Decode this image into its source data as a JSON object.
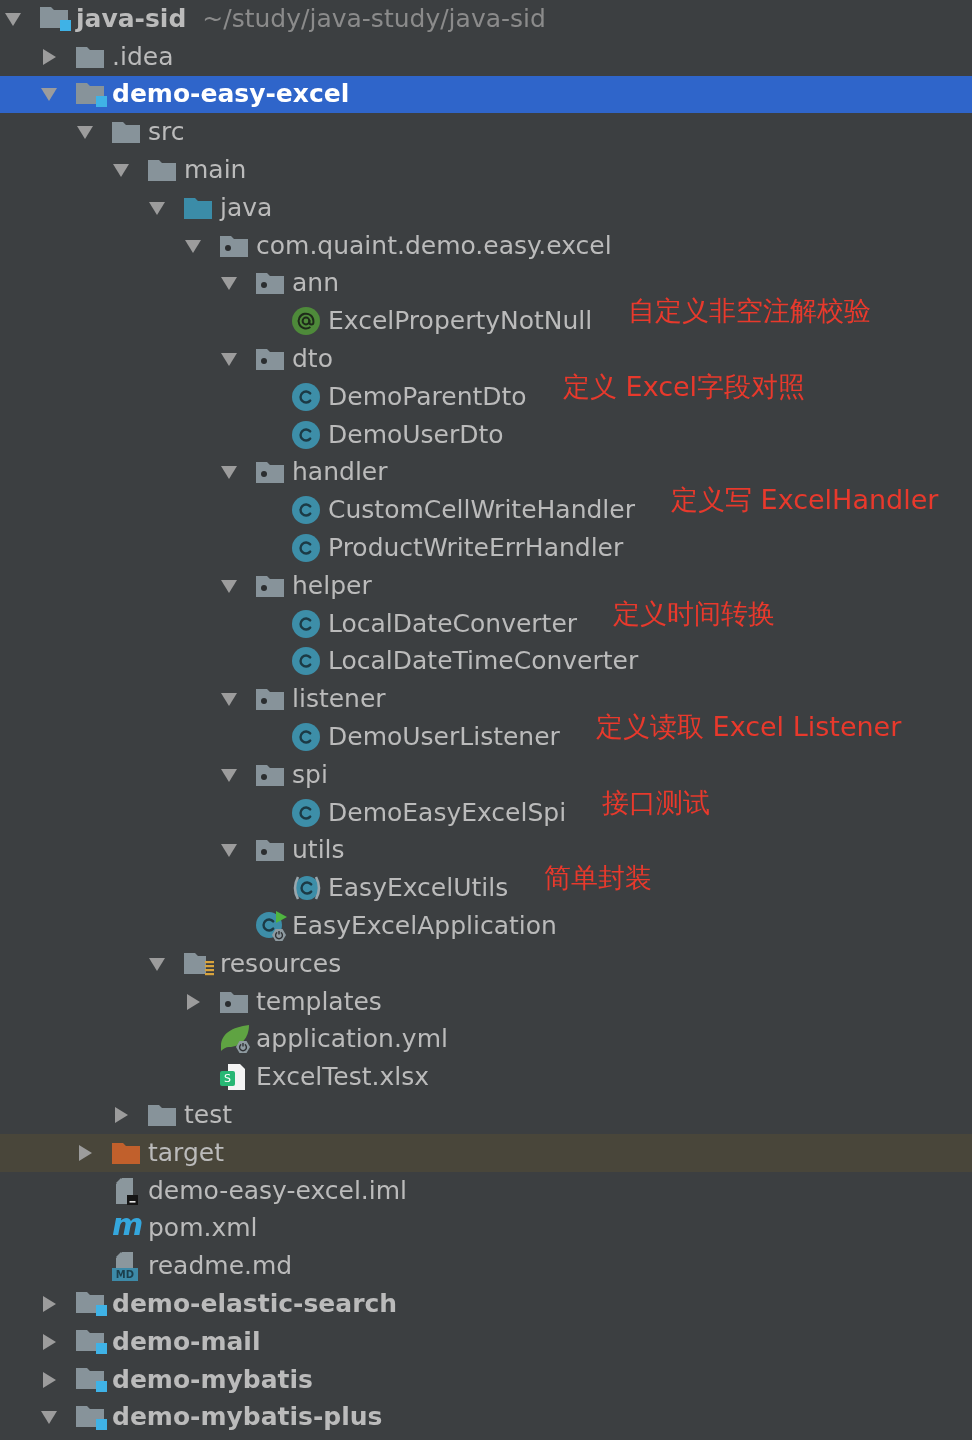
{
  "tree": [
    {
      "label": "java-sid",
      "kind": "module",
      "path": "~/study/java-study/java-sid",
      "expanded": true,
      "selected": false,
      "children": [
        {
          "label": ".idea",
          "kind": "folder",
          "expanded": false,
          "selected": false
        },
        {
          "label": "demo-easy-excel",
          "kind": "module",
          "expanded": true,
          "selected": true,
          "children": [
            {
              "label": "src",
              "kind": "folder",
              "expanded": true,
              "selected": false,
              "children": [
                {
                  "label": "main",
                  "kind": "folder",
                  "expanded": true,
                  "selected": false,
                  "children": [
                    {
                      "label": "java",
                      "kind": "source-folder",
                      "expanded": true,
                      "selected": false,
                      "children": [
                        {
                          "label": "com.quaint.demo.easy.excel",
                          "kind": "package",
                          "expanded": true,
                          "selected": false,
                          "children": [
                            {
                              "label": "ann",
                              "kind": "package",
                              "expanded": true,
                              "selected": false,
                              "children": [
                                {
                                  "label": "ExcelPropertyNotNull",
                                  "kind": "annotation",
                                  "selected": false,
                                  "note": "自定义非空注解校验"
                                }
                              ]
                            },
                            {
                              "label": "dto",
                              "kind": "package",
                              "expanded": true,
                              "selected": false,
                              "children": [
                                {
                                  "label": "DemoParentDto",
                                  "kind": "class",
                                  "selected": false,
                                  "note": "定义 Excel字段对照"
                                },
                                {
                                  "label": "DemoUserDto",
                                  "kind": "class",
                                  "selected": false
                                }
                              ]
                            },
                            {
                              "label": "handler",
                              "kind": "package",
                              "expanded": true,
                              "selected": false,
                              "children": [
                                {
                                  "label": "CustomCellWriteHandler",
                                  "kind": "class",
                                  "selected": false,
                                  "note": "定义写 ExcelHandler"
                                },
                                {
                                  "label": "ProductWriteErrHandler",
                                  "kind": "class",
                                  "selected": false
                                }
                              ]
                            },
                            {
                              "label": "helper",
                              "kind": "package",
                              "expanded": true,
                              "selected": false,
                              "children": [
                                {
                                  "label": "LocalDateConverter",
                                  "kind": "class",
                                  "selected": false,
                                  "note": "定义时间转换"
                                },
                                {
                                  "label": "LocalDateTimeConverter",
                                  "kind": "class",
                                  "selected": false
                                }
                              ]
                            },
                            {
                              "label": "listener",
                              "kind": "package",
                              "expanded": true,
                              "selected": false,
                              "children": [
                                {
                                  "label": "DemoUserListener",
                                  "kind": "class",
                                  "selected": false,
                                  "note": "定义读取 Excel Listener"
                                }
                              ]
                            },
                            {
                              "label": "spi",
                              "kind": "package",
                              "expanded": true,
                              "selected": false,
                              "children": [
                                {
                                  "label": "DemoEasyExcelSpi",
                                  "kind": "class",
                                  "selected": false,
                                  "note": "接口测试"
                                }
                              ]
                            },
                            {
                              "label": "utils",
                              "kind": "package",
                              "expanded": true,
                              "selected": false,
                              "children": [
                                {
                                  "label": "EasyExcelUtils",
                                  "kind": "utility-class",
                                  "selected": false,
                                  "note": "简单封装"
                                }
                              ]
                            },
                            {
                              "label": "EasyExcelApplication",
                              "kind": "spring-app",
                              "selected": false
                            }
                          ]
                        }
                      ]
                    },
                    {
                      "label": "resources",
                      "kind": "resources-folder",
                      "expanded": true,
                      "selected": false,
                      "children": [
                        {
                          "label": "templates",
                          "kind": "package",
                          "expanded": false,
                          "selected": false
                        },
                        {
                          "label": "application.yml",
                          "kind": "spring-config",
                          "selected": false
                        },
                        {
                          "label": "ExcelTest.xlsx",
                          "kind": "spreadsheet",
                          "badge": "S",
                          "selected": false
                        }
                      ]
                    }
                  ]
                },
                {
                  "label": "test",
                  "kind": "folder",
                  "expanded": false,
                  "selected": false
                }
              ]
            },
            {
              "label": "target",
              "kind": "excluded-folder",
              "expanded": false,
              "selected": false
            },
            {
              "label": "demo-easy-excel.iml",
              "kind": "module-file",
              "selected": false
            },
            {
              "label": "pom.xml",
              "kind": "maven",
              "glyph": "m",
              "selected": false
            },
            {
              "label": "readme.md",
              "kind": "markdown",
              "badge": "MD",
              "selected": false
            }
          ]
        },
        {
          "label": "demo-elastic-search",
          "kind": "module",
          "expanded": false,
          "selected": false
        },
        {
          "label": "demo-mail",
          "kind": "module",
          "expanded": false,
          "selected": false
        },
        {
          "label": "demo-mybatis",
          "kind": "module",
          "expanded": false,
          "selected": false
        },
        {
          "label": "demo-mybatis-plus",
          "kind": "module",
          "expanded": true,
          "selected": false
        }
      ]
    }
  ]
}
